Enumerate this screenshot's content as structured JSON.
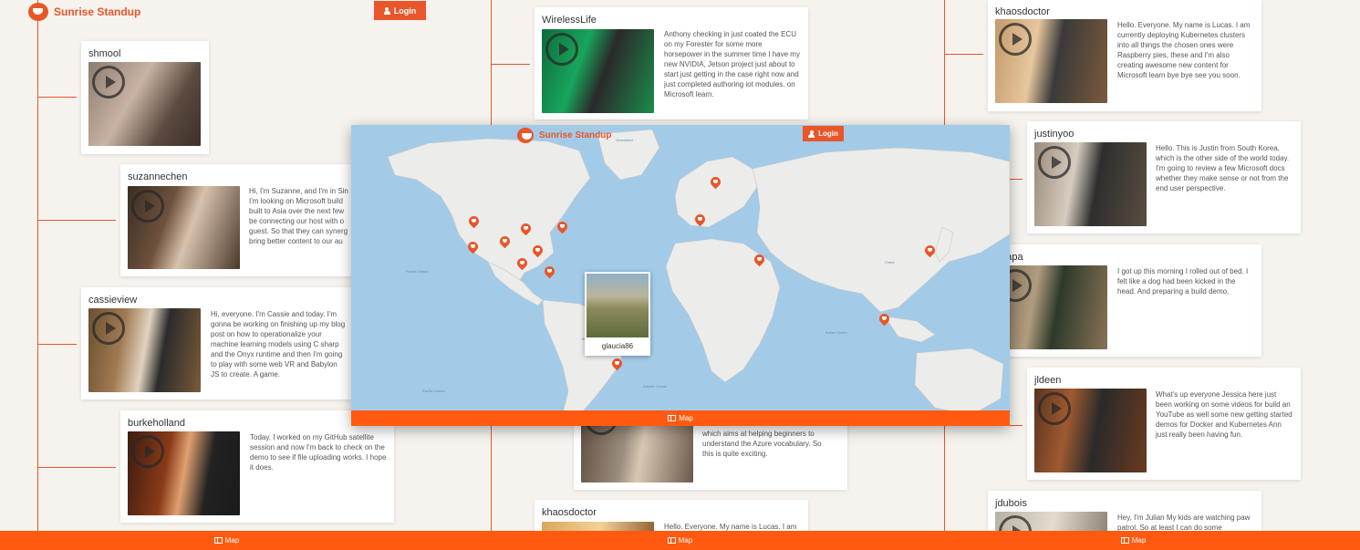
{
  "app": {
    "title": "Sunrise Standup",
    "login_label": "Login",
    "map_label": "Map"
  },
  "colors": {
    "accent": "#e8562a",
    "mapbar": "#ff5a0f",
    "ocean": "#a3cbe8",
    "land": "#ececea"
  },
  "icons": {
    "logo": "coffee-cup-icon",
    "login": "user-icon",
    "map": "map-icon",
    "video": "play-icon",
    "marker": "map-pin-icon"
  },
  "column1": {
    "cards": [
      {
        "user": "shmool",
        "text": ""
      },
      {
        "user": "suzannechen",
        "text": "Hi, I'm Suzanne, and I'm in Sin I'm looking on Microsoft build built to Asia over the next few be connecting our host with o guest. So that they can synerg bring better content to our au"
      },
      {
        "user": "cassieview",
        "text": "Hi, everyone. I'm Cassie and today. I'm gonna be working on finishing up my blog post on how to operationalize your machine learning models using C sharp and the Onyx runtime and then I'm going to play with some web VR and Babylon JS to create. A game."
      },
      {
        "user": "burkeholland",
        "text": "Today. I worked on my GitHub satellite session and now I'm back to check on the demo to see if file uploading works. I hope it does."
      }
    ]
  },
  "column2": {
    "cards": [
      {
        "user": "WirelessLife",
        "text": "Anthony checking in just coated the ECU on my Forester for some more horsepower in the summer time I have my new NVIDIA, Jetson project just about to start just getting in the case right now and just completed authoring iot modules. on Microsoft learn."
      },
      {
        "user": "",
        "text": "which aims at helping beginners to understand the Azure vocabulary. So this is quite exciting."
      },
      {
        "user": "khaosdoctor",
        "text": "Hello. Everyone. My name is Lucas. I am"
      }
    ]
  },
  "column3": {
    "cards": [
      {
        "user": "khaosdoctor",
        "text": "Hello. Everyone. My name is Lucas. I am currently deploying Kubernetes clusters into all things the chosen ones were Raspberry pies, these and I'm also creating awesome new content for Microsoft learn bye bye see you soon."
      },
      {
        "user": "justinyoo",
        "text": "Hello. This is Justin from South Korea, which is the other side of the world today. I'm going to review a few Microsoft docs whether they make sense or not from the end user perspective."
      },
      {
        "user": "npapa",
        "text": "I got up this morning I rolled out of bed. I felt like a dog had been kicked in the head. And preparing a build demo."
      },
      {
        "user": "jldeen",
        "text": "What's up everyone Jessica here just been working on some videos for build an YouTube as well some new getting started demos for Docker and Kubernetes Ann just really been having fun."
      },
      {
        "user": "jdubois",
        "text": "Hey, I'm Julian My kids are watching paw patrol. So at least I can do some"
      }
    ]
  },
  "map": {
    "popup_user": "glaucia86",
    "labels": {
      "pacific_left": "Pacific Ocean",
      "pacific_bottom": "Pacific Ocean",
      "atlantic": "Atlantic Ocean",
      "indian": "Indian Ocean",
      "greenland": "Greenland",
      "china": "China",
      "brazil": "Brazil"
    }
  }
}
